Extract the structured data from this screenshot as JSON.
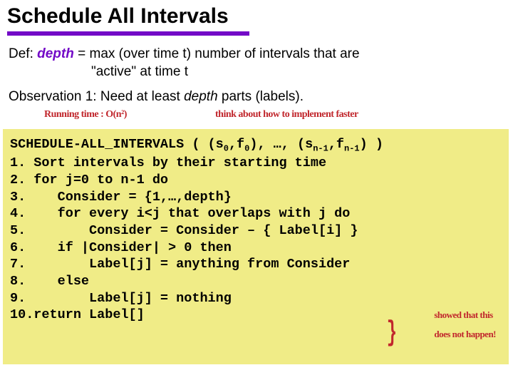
{
  "title": "Schedule All Intervals",
  "def": {
    "prefix": "Def: ",
    "depth": "depth",
    "rest1": " = max (over time t) number of intervals that are",
    "rest2": "\"active\" at time t"
  },
  "obs": {
    "prefix": "Observation 1: Need at least ",
    "depth_word": "depth",
    "suffix": " parts (labels)."
  },
  "hand": {
    "left": "Running time :   O(n²)",
    "right": "think about how to implement faster"
  },
  "code": {
    "header_a": "SCHEDULE-ALL_INTERVALS ( (s",
    "sub0a": "0",
    "header_b": ",f",
    "sub0b": "0",
    "header_c": "), …, (s",
    "subn1a": "n-1",
    "header_d": ",f",
    "subn1b": "n-1",
    "header_e": ") )",
    "l1": "1. Sort intervals by their starting time",
    "l2": "2. for j=0 to n-1 do",
    "l3": "3.    Consider = {1,…,depth}",
    "l4": "4.    for every i<j that overlaps with j do",
    "l5": "5.        Consider = Consider – { Label[i] }",
    "l6": "6.    if |Consider| > 0 then",
    "l7": "7.        Label[j] = anything from Consider",
    "l8": "8.    else",
    "l9": "9.        Label[j] = nothing",
    "l10": "10.return Label[]"
  },
  "side_note": {
    "brace": "}",
    "line1": "showed that this",
    "line2": "does not happen!"
  }
}
